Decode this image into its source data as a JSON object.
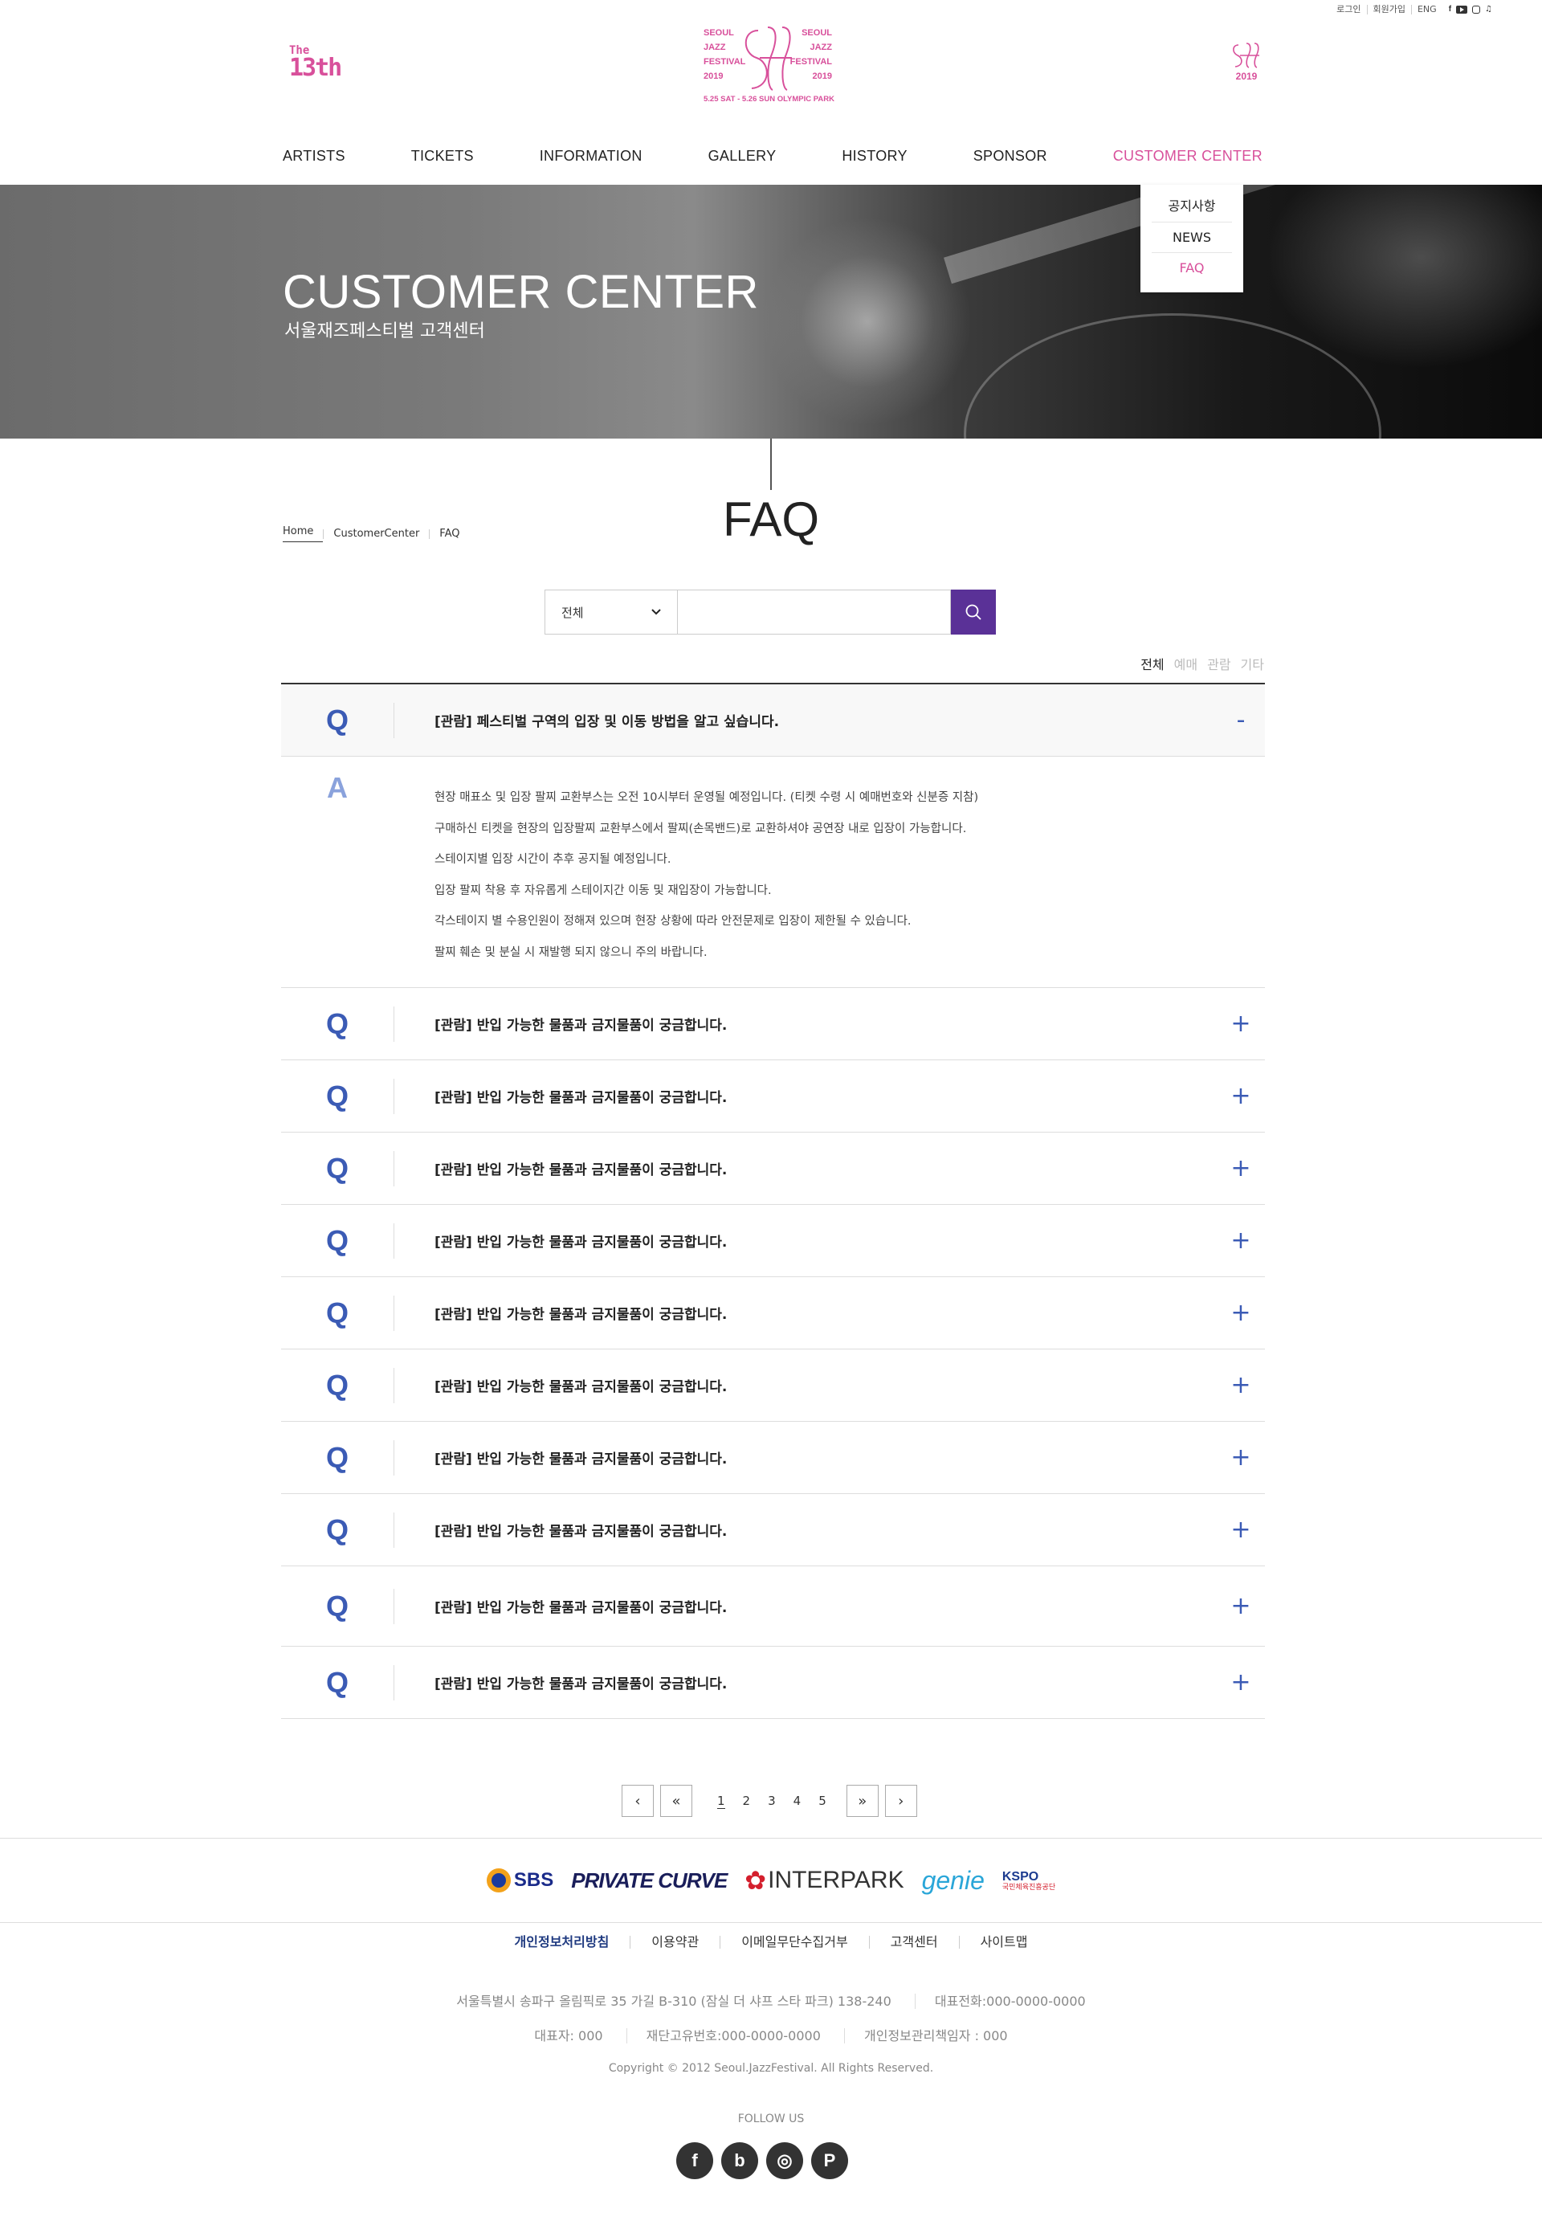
{
  "util": {
    "login": "로그인",
    "join": "회원가입",
    "lang": "ENG"
  },
  "header": {
    "badge_the": "The",
    "badge_13": "13th",
    "logo_left": [
      "SEOUL",
      "JAZZ",
      "FESTIVAL",
      "2019"
    ],
    "logo_right": [
      "SEOUL",
      "JAZZ",
      "FESTIVAL",
      "2019"
    ],
    "logo_date": "5.25 SAT - 5.26 SUN OLYMPIC PARK",
    "logo_right_year": "2019"
  },
  "nav": {
    "items": [
      "ARTISTS",
      "TICKETS",
      "INFORMATION",
      "GALLERY",
      "HISTORY",
      "SPONSOR",
      "CUSTOMER CENTER"
    ],
    "active_index": 6
  },
  "submenu": [
    "공지사항",
    "NEWS",
    "FAQ"
  ],
  "hero": {
    "title": "CUSTOMER CENTER",
    "subtitle": "서울재즈페스티벌 고객센터"
  },
  "breadcrumb": [
    "Home",
    "CustomerCenter",
    "FAQ"
  ],
  "page_title": "FAQ",
  "search": {
    "category": "전체",
    "value": "",
    "placeholder": ""
  },
  "filters": [
    "전체",
    "예매",
    "관람",
    "기타"
  ],
  "faq": {
    "open": {
      "q_mark": "Q",
      "question": "[관람] 페스티벌 구역의 입장 및 이동 방법을 알고 싶습니다.",
      "toggle": "-",
      "a_mark": "A",
      "answer": [
        "현장 매표소 및 입장 팔찌 교환부스는 오전 10시부터 운영될 예정입니다. (티켓 수령 시 예매번호와 신분증 지참)",
        "구매하신 티켓을 현장의 입장팔찌 교환부스에서 팔찌(손목밴드)로 교환하셔야 공연장 내로 입장이 가능합니다.",
        "스테이지별 입장 시간이 추후 공지될 예정입니다.",
        "입장 팔찌 착용 후 자유롭게 스테이지간 이동 및 재입장이 가능합니다.",
        "각스테이지 별 수용인원이 정해져 있으며 현장 상황에 따라 안전문제로 입장이 제한될 수 있습니다.",
        "팔찌 훼손 및 분실 시 재발행 되지 않으니 주의 바랍니다."
      ]
    },
    "items": [
      {
        "q": "Q",
        "question": "[관람] 반입 가능한 물품과 금지물품이 궁금합니다.",
        "toggle": "+"
      },
      {
        "q": "Q",
        "question": "[관람] 반입 가능한 물품과 금지물품이 궁금합니다.",
        "toggle": "+"
      },
      {
        "q": "Q",
        "question": "[관람] 반입 가능한 물품과 금지물품이 궁금합니다.",
        "toggle": "+"
      },
      {
        "q": "Q",
        "question": "[관람] 반입 가능한 물품과 금지물품이 궁금합니다.",
        "toggle": "+"
      },
      {
        "q": "Q",
        "question": "[관람] 반입 가능한 물품과 금지물품이 궁금합니다.",
        "toggle": "+"
      },
      {
        "q": "Q",
        "question": "[관람] 반입 가능한 물품과 금지물품이 궁금합니다.",
        "toggle": "+"
      },
      {
        "q": "Q",
        "question": "[관람] 반입 가능한 물품과 금지물품이 궁금합니다.",
        "toggle": "+"
      },
      {
        "q": "Q",
        "question": "[관람] 반입 가능한 물품과 금지물품이 궁금합니다.",
        "toggle": "+"
      },
      {
        "q": "Q",
        "question": "[관람] 반입 가능한 물품과 금지물품이 궁금합니다.",
        "toggle": "+"
      },
      {
        "q": "Q",
        "question": "[관람] 반입 가능한 물품과 금지물품이 궁금합니다.",
        "toggle": "+"
      }
    ]
  },
  "pagination": {
    "prev": "‹",
    "first": "«",
    "pages": [
      "1",
      "2",
      "3",
      "4",
      "5"
    ],
    "current": "1",
    "last": "»",
    "next": "›"
  },
  "sponsors": {
    "sbs": "SBS",
    "private_curve": "PRIVATE CURVE",
    "interpark": "INTERPARK",
    "genie": "genie",
    "kspo": "KSPO",
    "kspo_sub": "국민체육진흥공단"
  },
  "footer": {
    "links": [
      "개인정보처리방침",
      "이용약관",
      "이메일무단수집거부",
      "고객센터",
      "사이트맵"
    ],
    "address": "서울특별시 송파구 올림픽로 35 가길 B-310 (잠실 더 샤프 스타 파크) 138-240",
    "phone": "대표전화:000-0000-0000",
    "ceo": "대표자: 000",
    "biz_no": "재단고유번호:000-0000-0000",
    "privacy_officer": "개인정보관리책임자 : 000",
    "copyright": "Copyright © 2012 Seoul.JazzFestival. All Rights Reserved.",
    "follow": "FOLLOW US",
    "sns": [
      "f",
      "b",
      "◎",
      "P"
    ]
  },
  "colors": {
    "brand_pink": "#d8509b",
    "accent_purple": "#5a3197",
    "q_blue": "#3b5bb5"
  }
}
